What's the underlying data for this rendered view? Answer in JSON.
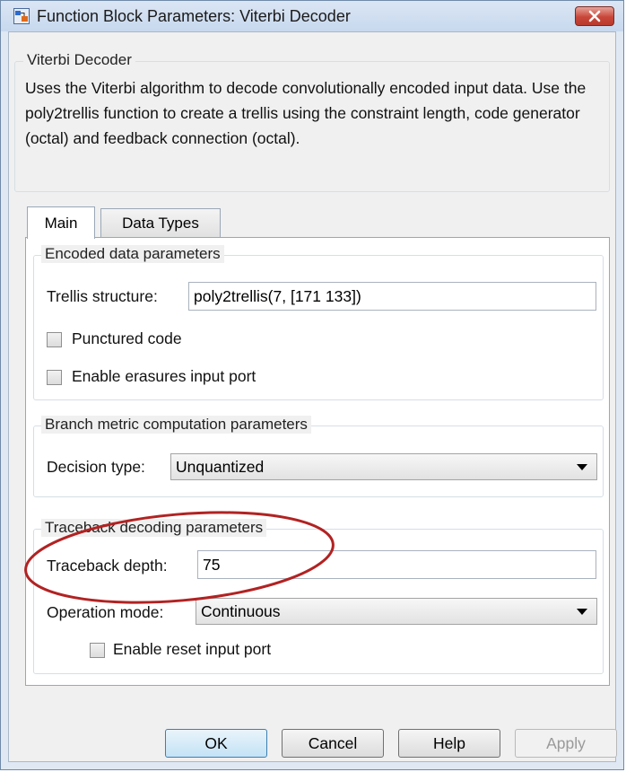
{
  "window": {
    "title": "Function Block Parameters: Viterbi Decoder"
  },
  "block": {
    "name": "Viterbi Decoder",
    "description": "Uses the Viterbi algorithm to decode convolutionally encoded input data.  Use the poly2trellis function to create a trellis using the constraint length, code generator (octal) and feedback connection (octal)."
  },
  "tabs": [
    {
      "label": "Main",
      "active": true
    },
    {
      "label": "Data Types",
      "active": false
    }
  ],
  "encoded": {
    "legend": "Encoded data parameters",
    "trellis_label": "Trellis structure:",
    "trellis_value": "poly2trellis(7, [171 133])",
    "punctured_label": "Punctured code",
    "punctured_checked": false,
    "erasures_label": "Enable erasures input port",
    "erasures_checked": false
  },
  "branch": {
    "legend": "Branch metric computation parameters",
    "decision_label": "Decision type:",
    "decision_value": "Unquantized"
  },
  "traceback": {
    "legend": "Traceback decoding parameters",
    "depth_label": "Traceback depth:",
    "depth_value": "75",
    "mode_label": "Operation mode:",
    "mode_value": "Continuous",
    "reset_label": "Enable reset input port",
    "reset_checked": false
  },
  "buttons": {
    "ok": "OK",
    "cancel": "Cancel",
    "help": "Help",
    "apply": "Apply"
  },
  "colors": {
    "annotation": "#b22222",
    "default_button": "#3c7fb1"
  },
  "icons": {
    "app": "simulink-block-icon",
    "close": "close-icon",
    "dropdown": "chevron-down-icon"
  }
}
